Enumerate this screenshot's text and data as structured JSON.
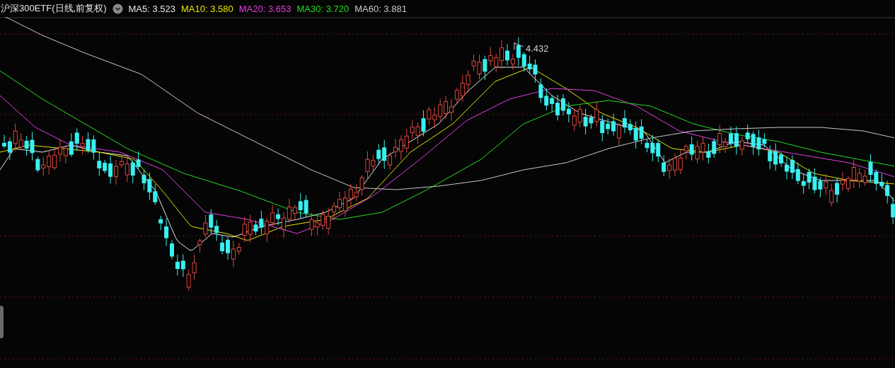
{
  "chart_header": {
    "title": "沪深300ETF(日线,前复权)",
    "moving_averages": [
      {
        "label": "MA5: 3.523",
        "color": "#e6e6e6"
      },
      {
        "label": "MA10: 3.580",
        "color": "#e6e600"
      },
      {
        "label": "MA20: 3.653",
        "color": "#e040e0"
      },
      {
        "label": "MA30: 3.720",
        "color": "#22dd22"
      },
      {
        "label": "MA60: 3.881",
        "color": "#c8c8c8"
      }
    ]
  },
  "peak_label": "4.432"
}
